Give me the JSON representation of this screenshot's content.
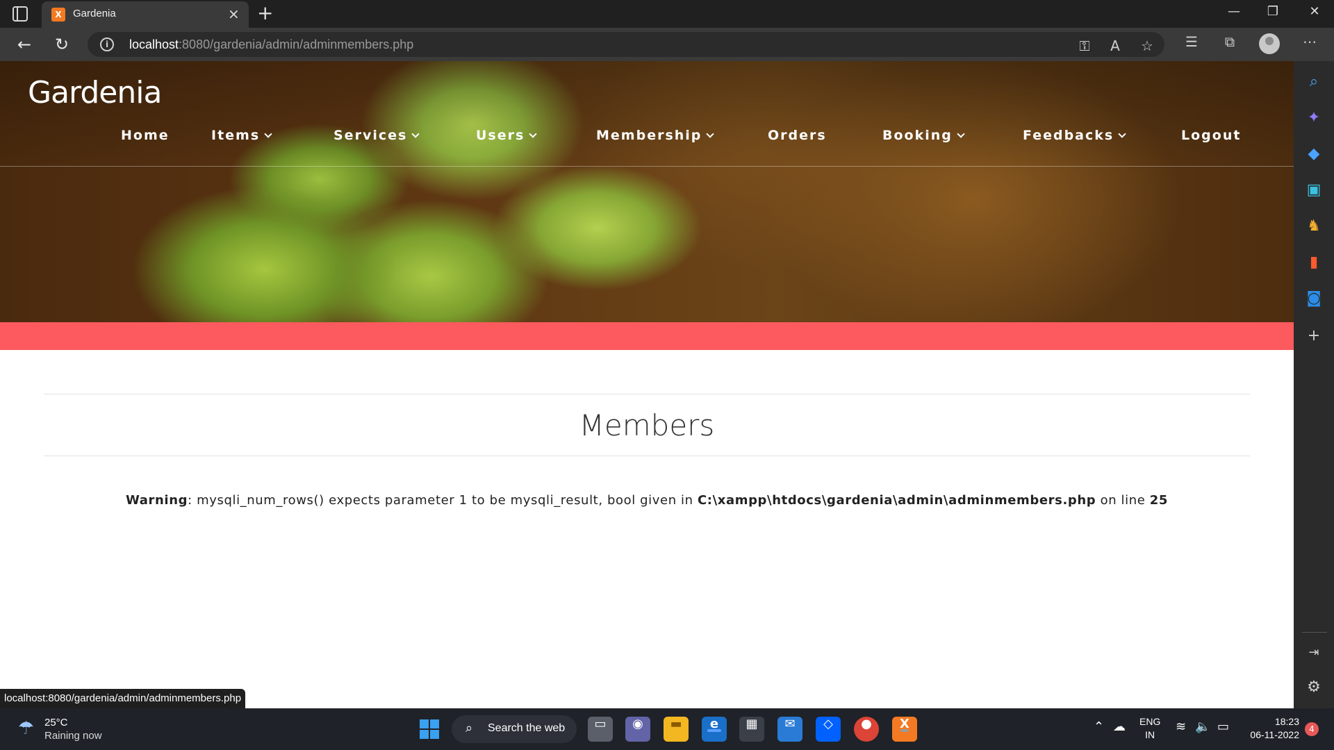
{
  "browser": {
    "tab_title": "Gardenia",
    "tab_favicon_text": "X",
    "url_host": "localhost",
    "url_rest": ":8080/gardenia/admin/adminmembers.php",
    "status_url": "localhost:8080/gardenia/admin/adminmembers.php"
  },
  "site": {
    "logo": "Gardenia",
    "nav": [
      {
        "label": "Home",
        "dropdown": false
      },
      {
        "label": "Items",
        "dropdown": true
      },
      {
        "label": "Services",
        "dropdown": true
      },
      {
        "label": "Users",
        "dropdown": true
      },
      {
        "label": "Membership",
        "dropdown": true
      },
      {
        "label": "Orders",
        "dropdown": false
      },
      {
        "label": "Booking",
        "dropdown": true
      },
      {
        "label": "Feedbacks",
        "dropdown": true
      },
      {
        "label": "Logout",
        "dropdown": false
      }
    ],
    "accent_color": "#fc5a5e"
  },
  "main": {
    "title": "Members",
    "warning": {
      "label": "Warning",
      "message": ": mysqli_num_rows() expects parameter 1 to be mysqli_result, bool given in ",
      "path": "C:\\xampp\\htdocs\\gardenia\\admin\\adminmembers.php",
      "on_line": " on line ",
      "line": "25"
    }
  },
  "taskbar": {
    "weather_temp": "25°C",
    "weather_condition": "Raining now",
    "search_label": "Search the web",
    "lang_1": "ENG",
    "lang_2": "IN",
    "time": "18:23",
    "date": "06-11-2022",
    "notification_count": "4"
  }
}
